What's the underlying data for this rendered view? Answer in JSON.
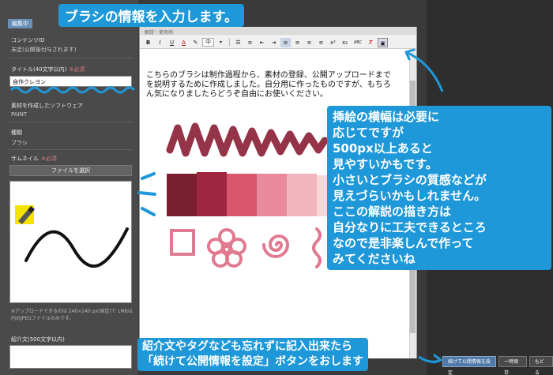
{
  "sidebar": {
    "badge": "編集中",
    "content_id_label": "コンテンツID",
    "content_id_value": "未定(公開後付与されます)",
    "title_label": "タイトル",
    "title_hint": "(40文字以内)",
    "required_text": "※必須",
    "title_value": "自作クレヨン",
    "software_label": "素材を作成したソフトウェア",
    "software_value": "PAINT",
    "type_label": "種類",
    "type_value": "ブラシ",
    "thumbnail_label": "サムネイル",
    "file_button": "ファイルを選択",
    "upload_note": "※アップロードできるのは 240×240 px(固定)で 1MB以内のJPEGファイルのみです。",
    "intro_label": "紹介文",
    "intro_hint": "(500文字以内)"
  },
  "editor": {
    "header": "解説・使用例",
    "font_size": "中",
    "body_text": "こちらのブラシは制作過程から、素材の登録、公開アップロードまでを説明するために作成しました。自分用に作ったものですが、もちろん気になりましたらどうぞ自由にお使いください。",
    "toolbar": {
      "bold": "B",
      "italic": "I",
      "underline": "U",
      "strike": "A",
      "sup": "x²",
      "sub": "x₂",
      "abc": "ABC"
    }
  },
  "buttons": {
    "continue": "続けて公開情報を設定",
    "temp_save": "一時保存",
    "back": "もどる"
  },
  "annotations": {
    "title": "ブラシの情報を入力します。",
    "side_lines": [
      "挿絵の横幅は必要に",
      "応じてですが",
      "500px以上あると",
      "見やすいかもです。",
      "小さいとブラシの質感などが",
      "見えづらいかもしれません。",
      "ここの解説の描き方は",
      "自分なりに工夫できるところ",
      "なので是非楽しんで作って",
      "みてくださいね"
    ],
    "bottom_line1": "紹介文やタグなども忘れずに記入出来たら",
    "bottom_line2": "「続けて公開情報を設定」ボタンをおします"
  },
  "colors": {
    "annotation": "#1e98d8",
    "swatches": [
      "#7a1f2e",
      "#a0263f",
      "#d9566d",
      "#e88a99",
      "#f2b5bd",
      "#f9d6d9"
    ]
  }
}
